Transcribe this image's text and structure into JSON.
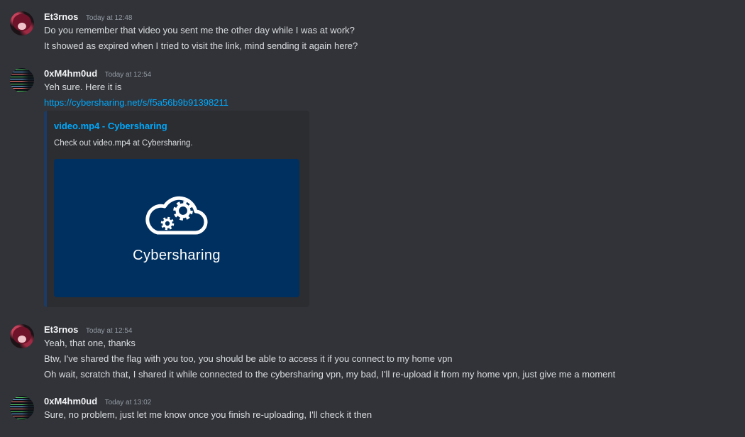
{
  "theme": {
    "background": "#313338",
    "text": "#dbdee1",
    "author": "#f2f3f5",
    "timestamp": "#949ba4",
    "link": "#00a8fc",
    "embed_background": "#2b2d31",
    "embed_accent": "#1c3b64",
    "embed_image_background": "#003060"
  },
  "messages": [
    {
      "author": "Et3rnos",
      "timestamp": "Today at 12:48",
      "lines": [
        "Do you remember that video you sent me the other day while I was at work?",
        "It showed as expired when I tried to visit the link, mind sending it again here?"
      ]
    },
    {
      "author": "0xM4hm0ud",
      "timestamp": "Today at 12:54",
      "lines": [
        "Yeh sure. Here it is"
      ],
      "link": "https://cybersharing.net/s/f5a56b9b91398211",
      "embed": {
        "title": "video.mp4 - Cybersharing",
        "description": "Check out video.mp4 at Cybersharing.",
        "image_icon": "cloud-gears-icon",
        "image_caption": "Cybersharing"
      }
    },
    {
      "author": "Et3rnos",
      "timestamp": "Today at 12:54",
      "lines": [
        "Yeah, that one, thanks",
        "Btw, I've shared the flag with you too, you should be able to access it if you connect to my home vpn",
        "Oh wait, scratch that, I shared it while connected to the cybersharing vpn, my bad, I'll re-upload it from my home vpn, just give me a moment"
      ]
    },
    {
      "author": "0xM4hm0ud",
      "timestamp": "Today at 13:02",
      "lines": [
        "Sure, no problem, just let me know once you finish re-uploading, I'll check it then"
      ]
    }
  ]
}
